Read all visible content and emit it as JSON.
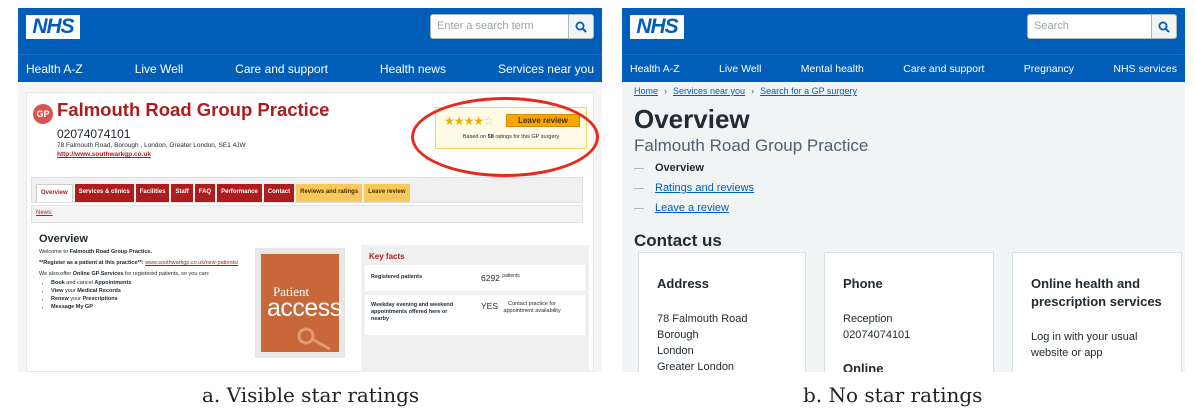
{
  "colors": {
    "nhs_blue": "#005eb8",
    "practice_red": "#ae1d1d",
    "star_gold": "#f0ad00",
    "highlight_ring": "#e8291c",
    "button_orange": "#f6a800"
  },
  "panel_a": {
    "logo": "NHS",
    "search_placeholder": "Enter a search term",
    "nav": [
      "Health A-Z",
      "Live Well",
      "Care and support",
      "Health news",
      "Services near you"
    ],
    "gp_badge": "GP",
    "practice_name": "Falmouth Road Group Practice",
    "phone": "02074074101",
    "address": "78 Falmouth Road, Borough , London, Greater London, SE1 4JW",
    "website": "http://www.southwarkgp.co.uk",
    "rating": {
      "stars": 3.5,
      "max": 5,
      "leave_review": "Leave review",
      "based_prefix": "Based on ",
      "count": "58",
      "based_suffix": " ratings for this GP surgery"
    },
    "tabs": [
      "Overview",
      "Services & clinics",
      "Facilities",
      "Staff",
      "FAQ",
      "Performance",
      "Contact",
      "Reviews and ratings",
      "Leave review"
    ],
    "news": "News:",
    "overview_heading": "Overview",
    "welcome_pre": "Welcome to ",
    "welcome_bold": "Falmouth Road Group Practice.",
    "register_text": "**Register as a patient at this practice**: ",
    "register_link": "www.southwarkgp.co.uk/new-patients/",
    "online_pre": "We also offer ",
    "online_bold": "Online GP Services",
    "online_post": " for registered patients, so you can:",
    "bullets": [
      {
        "bold1": "Book",
        "mid": " and cancel ",
        "bold2": "Appointments"
      },
      {
        "bold1": "View",
        "mid": " your ",
        "bold2": "Medical Records"
      },
      {
        "bold1": "Renew",
        "mid": " your ",
        "bold2": "Prescriptions"
      },
      {
        "bold1": "Message My GP",
        "mid": "",
        "bold2": ""
      }
    ],
    "patient_access": {
      "line1": "Patient",
      "line2": "access"
    },
    "key_facts": {
      "heading": "Key facts",
      "rows": [
        {
          "label": "Registered patients",
          "value": "6292",
          "unit": "patients"
        },
        {
          "label": "Weekday evening and weekend appointments offered here or nearby",
          "value": "YES",
          "note": "Contact practice for appointment availability"
        }
      ]
    }
  },
  "panel_b": {
    "logo": "NHS",
    "search_placeholder": "Search",
    "nav": [
      "Health A-Z",
      "Live Well",
      "Mental health",
      "Care and support",
      "Pregnancy",
      "NHS services"
    ],
    "breadcrumb": [
      "Home",
      "Services near you",
      "Search for a GP surgery"
    ],
    "title": "Overview",
    "subtitle": "Falmouth Road Group Practice",
    "contents": [
      "Overview",
      "Ratings and reviews",
      "Leave a review"
    ],
    "contact_heading": "Contact us",
    "address_card": {
      "heading": "Address",
      "lines": [
        "78 Falmouth Road",
        "Borough",
        "London",
        "Greater London"
      ]
    },
    "phone_card": {
      "heading": "Phone",
      "label": "Reception",
      "number": "02074074101",
      "heading2": "Online"
    },
    "online_card": {
      "heading": "Online health and prescription services",
      "text": "Log in with your usual website or app"
    }
  },
  "captions": {
    "a": "a. Visible star ratings",
    "b": "b. No star ratings"
  }
}
